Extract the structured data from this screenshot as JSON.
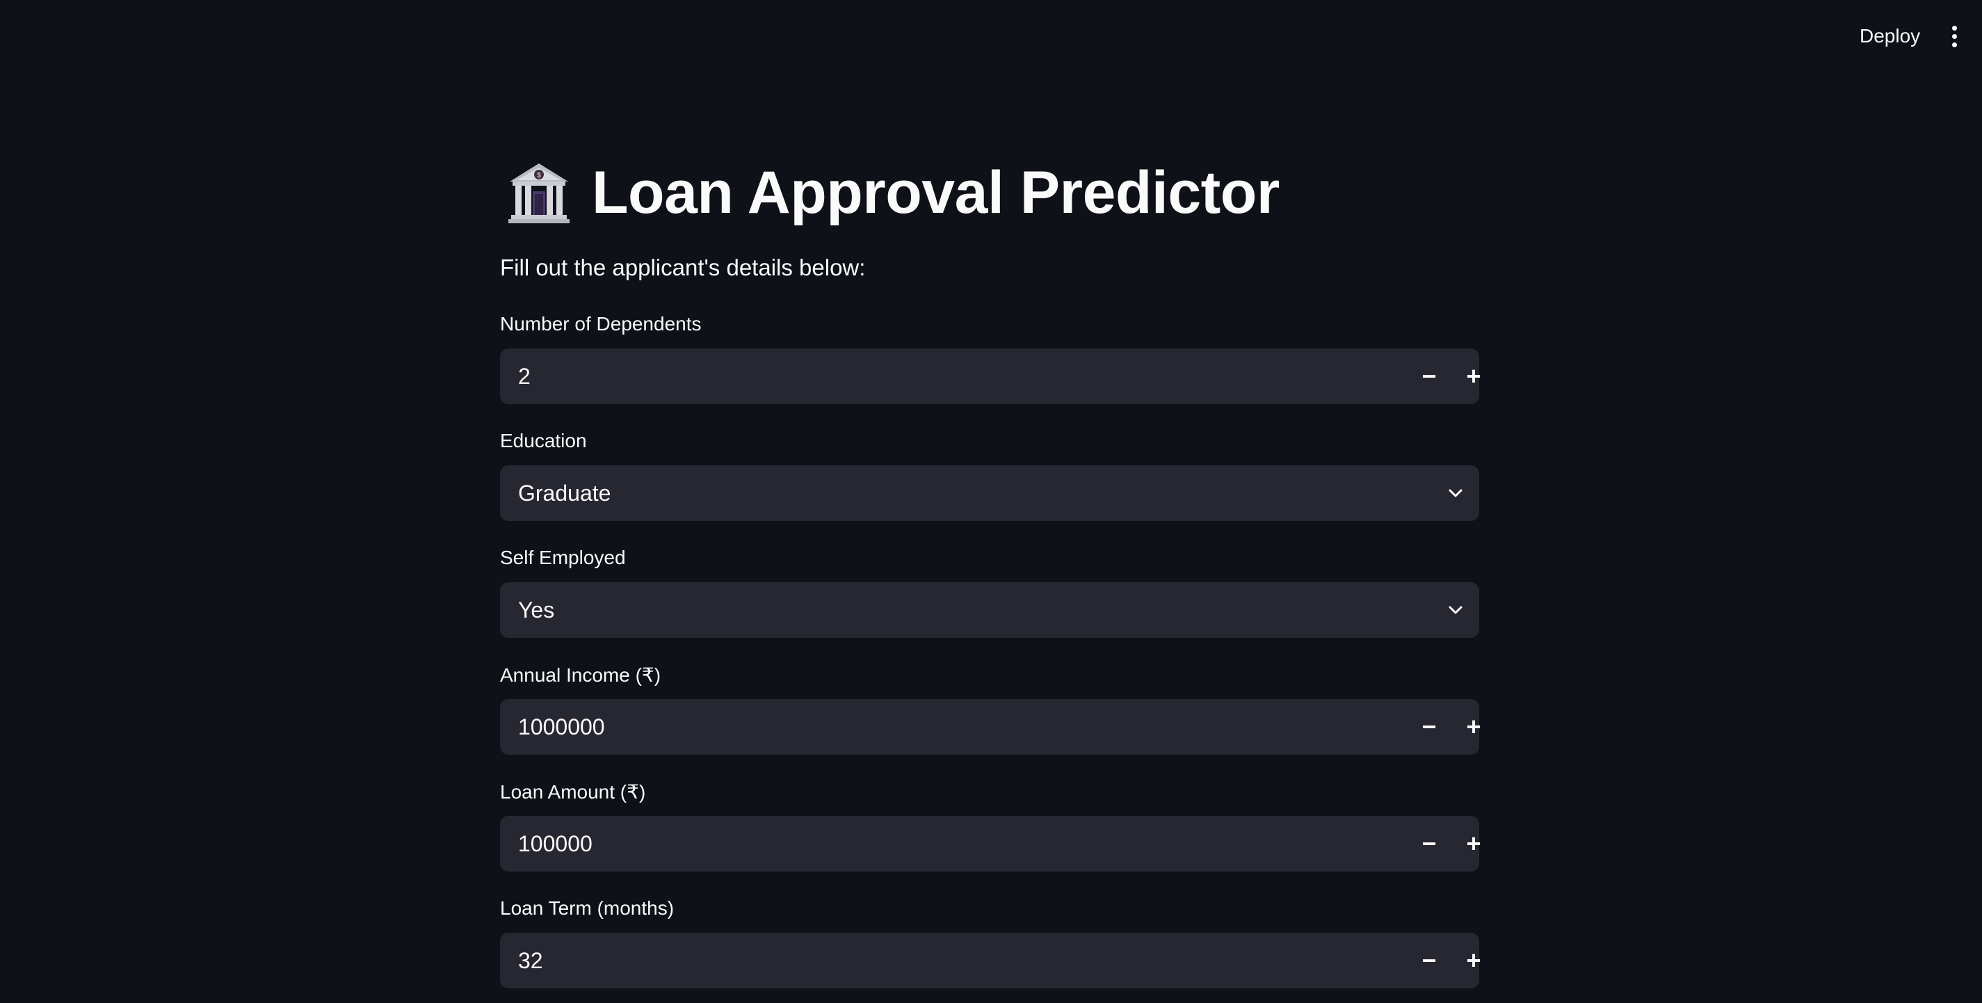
{
  "header": {
    "deploy_label": "Deploy",
    "menu_icon": "vertical-ellipsis-icon"
  },
  "main": {
    "title_icon": "bank-building-icon",
    "title": "Loan Approval Predictor",
    "subtitle": "Fill out the applicant's details below:",
    "fields": {
      "dependents": {
        "label": "Number of Dependents",
        "value": "2",
        "type": "number"
      },
      "education": {
        "label": "Education",
        "value": "Graduate",
        "type": "select"
      },
      "self_employed": {
        "label": "Self Employed",
        "value": "Yes",
        "type": "select"
      },
      "annual_income": {
        "label": "Annual Income (₹)",
        "value": "1000000",
        "type": "number"
      },
      "loan_amount": {
        "label": "Loan Amount (₹)",
        "value": "100000",
        "type": "number"
      },
      "loan_term": {
        "label": "Loan Term (months)",
        "value": "32",
        "type": "number"
      }
    },
    "stepper": {
      "minus_symbol": "−",
      "plus_symbol": "+"
    }
  },
  "colors": {
    "background": "#0e1117",
    "input_background": "#262730",
    "text": "#fafafa"
  }
}
